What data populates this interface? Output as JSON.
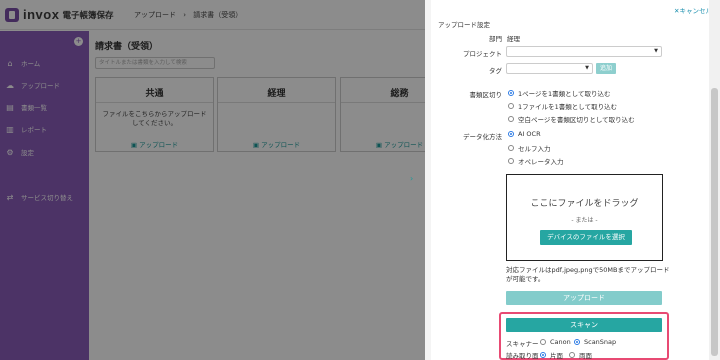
{
  "header": {
    "brand": "invox",
    "product": "電子帳簿保存",
    "breadcrumb": [
      "アップロード",
      "請求書（受領）"
    ]
  },
  "sidebar": {
    "collapse_icon": "plus-circle-icon",
    "items": [
      {
        "label": "ホーム",
        "icon": "home-icon"
      },
      {
        "label": "アップロード",
        "icon": "cloud-upload-icon"
      },
      {
        "label": "書類一覧",
        "icon": "document-icon"
      },
      {
        "label": "レポート",
        "icon": "chart-icon"
      },
      {
        "label": "設定",
        "icon": "gear-icon"
      },
      {
        "label": "サービス切り替え",
        "icon": "switch-icon"
      }
    ]
  },
  "main": {
    "title": "請求書（受領）",
    "search_placeholder": "タイトルまたは書類を入力して検索",
    "cards": [
      {
        "title": "共通",
        "desc": "ファイルをこちらからアップロードしてください。",
        "link": "アップロード"
      },
      {
        "title": "経理",
        "desc": "",
        "link": "アップロード"
      },
      {
        "title": "総務",
        "desc": "",
        "link": "アップロード"
      }
    ]
  },
  "panel": {
    "cancel": "キャンセル",
    "section_title": "アップロード設定",
    "department_label": "部門",
    "department_value": "経理",
    "project_label": "プロジェクト",
    "project_value": "",
    "tag_label": "タグ",
    "tag_value": "",
    "add_button": "追加",
    "split_label": "書類区切り",
    "split_options": [
      {
        "label": "1ページを1書類として取り込む",
        "selected": true
      },
      {
        "label": "1ファイルを1書類として取り込む",
        "selected": false
      },
      {
        "label": "空白ページを書類区切りとして取り込む",
        "selected": false
      }
    ],
    "datafy_label": "データ化方法",
    "datafy_options": [
      {
        "label": "AI OCR",
        "selected": true
      },
      {
        "label": "セルフ入力",
        "selected": false
      },
      {
        "label": "オペレータ入力",
        "selected": false
      }
    ],
    "dropzone_title": "ここにファイルをドラッグ",
    "dropzone_or": "- または -",
    "select_file_button": "デバイスのファイルを選択",
    "file_note": "対応ファイルはpdf,jpeg,pngで50MBまでアップロードが可能です。",
    "upload_button": "アップロード",
    "scan_button": "スキャン",
    "scanner_label": "スキャナー",
    "scanner_options": [
      {
        "label": "Canon",
        "selected": false
      },
      {
        "label": "ScanSnap",
        "selected": true
      }
    ],
    "read_label": "読み取り面",
    "read_options": [
      {
        "label": "片面",
        "selected": true
      },
      {
        "label": "両面",
        "selected": false
      }
    ],
    "accent_color": "#26a6a2",
    "highlight_color": "#e84a73"
  }
}
